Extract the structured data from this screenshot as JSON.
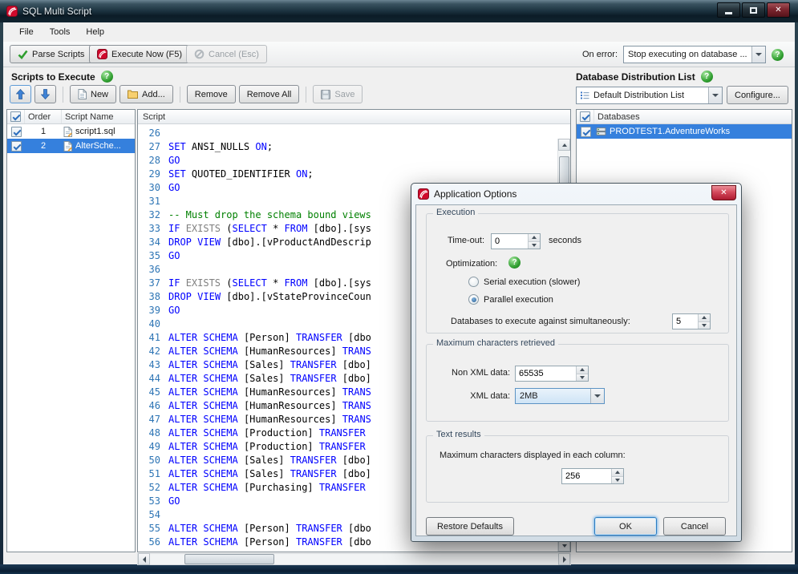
{
  "window": {
    "title": "SQL Multi Script"
  },
  "menubar": {
    "file": "File",
    "tools": "Tools",
    "help": "Help"
  },
  "toolbar": {
    "parse_label": "Parse Scripts",
    "execute_label": "Execute Now (F5)",
    "cancel_label": "Cancel (Esc)",
    "on_error_label": "On error:",
    "on_error_value": "Stop executing on database ..."
  },
  "scripts_panel": {
    "title": "Scripts to Execute",
    "new_label": "New",
    "add_label": "Add...",
    "remove_label": "Remove",
    "remove_all_label": "Remove All",
    "save_label": "Save",
    "col_order": "Order",
    "col_name": "Script Name",
    "check_all": true,
    "rows": [
      {
        "order": "1",
        "name": "script1.sql",
        "checked": true,
        "selected": false
      },
      {
        "order": "2",
        "name": "AlterSche...",
        "checked": true,
        "selected": true
      }
    ]
  },
  "editor": {
    "header": "Script",
    "lines": [
      {
        "n": 26,
        "t": []
      },
      {
        "n": 27,
        "t": [
          [
            "k",
            "SET"
          ],
          [
            "p",
            " ANSI_NULLS "
          ],
          [
            "k",
            "ON"
          ],
          [
            "p",
            ";"
          ]
        ]
      },
      {
        "n": 28,
        "t": [
          [
            "k",
            "GO"
          ]
        ]
      },
      {
        "n": 29,
        "t": [
          [
            "k",
            "SET"
          ],
          [
            "p",
            " QUOTED_IDENTIFIER "
          ],
          [
            "k",
            "ON"
          ],
          [
            "p",
            ";"
          ]
        ]
      },
      {
        "n": 30,
        "t": [
          [
            "k",
            "GO"
          ]
        ]
      },
      {
        "n": 31,
        "t": []
      },
      {
        "n": 32,
        "t": [
          [
            "c",
            "-- Must drop the schema bound views"
          ]
        ]
      },
      {
        "n": 33,
        "t": [
          [
            "k",
            "IF"
          ],
          [
            "p",
            " "
          ],
          [
            "g",
            "EXISTS"
          ],
          [
            "p",
            " ("
          ],
          [
            "k",
            "SELECT"
          ],
          [
            "p",
            " * "
          ],
          [
            "k",
            "FROM"
          ],
          [
            "p",
            " [dbo].[sys"
          ]
        ]
      },
      {
        "n": 34,
        "t": [
          [
            "k",
            "DROP"
          ],
          [
            "p",
            " "
          ],
          [
            "k",
            "VIEW"
          ],
          [
            "p",
            " [dbo].[vProductAndDescrip"
          ]
        ]
      },
      {
        "n": 35,
        "t": [
          [
            "k",
            "GO"
          ]
        ]
      },
      {
        "n": 36,
        "t": []
      },
      {
        "n": 37,
        "t": [
          [
            "k",
            "IF"
          ],
          [
            "p",
            " "
          ],
          [
            "g",
            "EXISTS"
          ],
          [
            "p",
            " ("
          ],
          [
            "k",
            "SELECT"
          ],
          [
            "p",
            " * "
          ],
          [
            "k",
            "FROM"
          ],
          [
            "p",
            " [dbo].[sys"
          ]
        ]
      },
      {
        "n": 38,
        "t": [
          [
            "k",
            "DROP"
          ],
          [
            "p",
            " "
          ],
          [
            "k",
            "VIEW"
          ],
          [
            "p",
            " [dbo].[vStateProvinceCoun"
          ]
        ]
      },
      {
        "n": 39,
        "t": [
          [
            "k",
            "GO"
          ]
        ]
      },
      {
        "n": 40,
        "t": []
      },
      {
        "n": 41,
        "t": [
          [
            "k",
            "ALTER"
          ],
          [
            "p",
            " "
          ],
          [
            "k",
            "SCHEMA"
          ],
          [
            "p",
            " [Person] "
          ],
          [
            "k",
            "TRANSFER"
          ],
          [
            "p",
            " [dbo"
          ]
        ]
      },
      {
        "n": 42,
        "t": [
          [
            "k",
            "ALTER"
          ],
          [
            "p",
            " "
          ],
          [
            "k",
            "SCHEMA"
          ],
          [
            "p",
            " [HumanResources] "
          ],
          [
            "k",
            "TRANS"
          ]
        ]
      },
      {
        "n": 43,
        "t": [
          [
            "k",
            "ALTER"
          ],
          [
            "p",
            " "
          ],
          [
            "k",
            "SCHEMA"
          ],
          [
            "p",
            " [Sales] "
          ],
          [
            "k",
            "TRANSFER"
          ],
          [
            "p",
            " [dbo]"
          ]
        ]
      },
      {
        "n": 44,
        "t": [
          [
            "k",
            "ALTER"
          ],
          [
            "p",
            " "
          ],
          [
            "k",
            "SCHEMA"
          ],
          [
            "p",
            " [Sales] "
          ],
          [
            "k",
            "TRANSFER"
          ],
          [
            "p",
            " [dbo]"
          ]
        ]
      },
      {
        "n": 45,
        "t": [
          [
            "k",
            "ALTER"
          ],
          [
            "p",
            " "
          ],
          [
            "k",
            "SCHEMA"
          ],
          [
            "p",
            " [HumanResources] "
          ],
          [
            "k",
            "TRANS"
          ]
        ]
      },
      {
        "n": 46,
        "t": [
          [
            "k",
            "ALTER"
          ],
          [
            "p",
            " "
          ],
          [
            "k",
            "SCHEMA"
          ],
          [
            "p",
            " [HumanResources] "
          ],
          [
            "k",
            "TRANS"
          ]
        ]
      },
      {
        "n": 47,
        "t": [
          [
            "k",
            "ALTER"
          ],
          [
            "p",
            " "
          ],
          [
            "k",
            "SCHEMA"
          ],
          [
            "p",
            " [HumanResources] "
          ],
          [
            "k",
            "TRANS"
          ]
        ]
      },
      {
        "n": 48,
        "t": [
          [
            "k",
            "ALTER"
          ],
          [
            "p",
            " "
          ],
          [
            "k",
            "SCHEMA"
          ],
          [
            "p",
            " [Production] "
          ],
          [
            "k",
            "TRANSFER"
          ]
        ]
      },
      {
        "n": 49,
        "t": [
          [
            "k",
            "ALTER"
          ],
          [
            "p",
            " "
          ],
          [
            "k",
            "SCHEMA"
          ],
          [
            "p",
            " [Production] "
          ],
          [
            "k",
            "TRANSFER"
          ]
        ]
      },
      {
        "n": 50,
        "t": [
          [
            "k",
            "ALTER"
          ],
          [
            "p",
            " "
          ],
          [
            "k",
            "SCHEMA"
          ],
          [
            "p",
            " [Sales] "
          ],
          [
            "k",
            "TRANSFER"
          ],
          [
            "p",
            " [dbo]"
          ]
        ]
      },
      {
        "n": 51,
        "t": [
          [
            "k",
            "ALTER"
          ],
          [
            "p",
            " "
          ],
          [
            "k",
            "SCHEMA"
          ],
          [
            "p",
            " [Sales] "
          ],
          [
            "k",
            "TRANSFER"
          ],
          [
            "p",
            " [dbo]"
          ]
        ]
      },
      {
        "n": 52,
        "t": [
          [
            "k",
            "ALTER"
          ],
          [
            "p",
            " "
          ],
          [
            "k",
            "SCHEMA"
          ],
          [
            "p",
            " [Purchasing] "
          ],
          [
            "k",
            "TRANSFER"
          ]
        ]
      },
      {
        "n": 53,
        "t": [
          [
            "k",
            "GO"
          ]
        ]
      },
      {
        "n": 54,
        "t": []
      },
      {
        "n": 55,
        "t": [
          [
            "k",
            "ALTER"
          ],
          [
            "p",
            " "
          ],
          [
            "k",
            "SCHEMA"
          ],
          [
            "p",
            " [Person] "
          ],
          [
            "k",
            "TRANSFER"
          ],
          [
            "p",
            " [dbo"
          ]
        ]
      },
      {
        "n": 56,
        "t": [
          [
            "k",
            "ALTER"
          ],
          [
            "p",
            " "
          ],
          [
            "k",
            "SCHEMA"
          ],
          [
            "p",
            " [Person] "
          ],
          [
            "k",
            "TRANSFER"
          ],
          [
            "p",
            " [dbo"
          ]
        ]
      }
    ]
  },
  "db_panel": {
    "title": "Database Distribution List",
    "list_value": "Default Distribution List",
    "configure_label": "Configure...",
    "col_databases": "Databases",
    "check_all": true,
    "rows": [
      {
        "name": "PRODTEST1.AdventureWorks",
        "checked": true,
        "selected": true
      }
    ]
  },
  "dialog": {
    "title": "Application Options",
    "execution": {
      "legend": "Execution",
      "timeout_label": "Time-out:",
      "timeout_value": "0",
      "timeout_unit": "seconds",
      "optimization_label": "Optimization:",
      "serial_label": "Serial execution (slower)",
      "serial_selected": false,
      "parallel_label": "Parallel execution",
      "parallel_selected": true,
      "simultaneous_label": "Databases to execute against simultaneously:",
      "simultaneous_value": "5"
    },
    "max_chars": {
      "legend": "Maximum characters retrieved",
      "non_xml_label": "Non XML data:",
      "non_xml_value": "65535",
      "xml_label": "XML data:",
      "xml_value": "2MB"
    },
    "text_results": {
      "legend": "Text results",
      "column_label": "Maximum characters displayed in each column:",
      "column_value": "256"
    },
    "buttons": {
      "restore": "Restore Defaults",
      "ok": "OK",
      "cancel": "Cancel"
    }
  },
  "icons": {
    "help_glyph": "?",
    "close_glyph": "✕",
    "app-icon": "red-gate-logo",
    "parse-icon": "green-check",
    "execute-icon": "red-gate-logo",
    "cancel-icon": "gray-no-entry",
    "move-up-icon": "blue-arrow-up",
    "move-down-icon": "blue-arrow-down",
    "new-icon": "document",
    "add-icon": "folder",
    "save-icon": "floppy-disk",
    "script-icon": "document-edit",
    "database-icon": "server",
    "list-icon": "distribution-list"
  },
  "colors": {
    "selection_blue": "#3580dd",
    "keyword_blue": "#0000ff",
    "comment_green": "#008000",
    "line_number_blue": "#2e75b5",
    "brand_red": "#cf0a2c",
    "help_green": "#2f9e2f"
  }
}
